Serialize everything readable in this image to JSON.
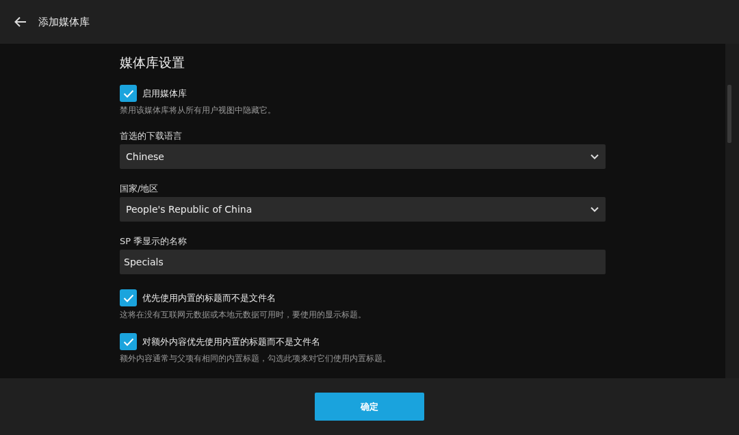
{
  "header": {
    "title": "添加媒体库"
  },
  "section": {
    "title": "媒体库设置"
  },
  "fields": [
    {
      "kind": "checkbox",
      "label": "启用媒体库",
      "checked": true,
      "description": "禁用该媒体库将从所有用户视图中隐藏它。"
    },
    {
      "kind": "select",
      "label": "首选的下载语言",
      "value": "Chinese"
    },
    {
      "kind": "select",
      "label": "国家/地区",
      "value": "People's Republic of China"
    },
    {
      "kind": "text",
      "label": "SP 季显示的名称",
      "value": "Specials"
    },
    {
      "kind": "checkbox",
      "label": "优先使用内置的标题而不是文件名",
      "checked": true,
      "description": "这将在没有互联网元数据或本地元数据可用时，要使用的显示标题。"
    },
    {
      "kind": "checkbox",
      "label": "对额外内容优先使用内置的标题而不是文件名",
      "checked": true,
      "description": "额外内容通常与父项有相同的内置标题，勾选此项来对它们使用内置标题。"
    }
  ],
  "footer": {
    "button": "确定"
  }
}
